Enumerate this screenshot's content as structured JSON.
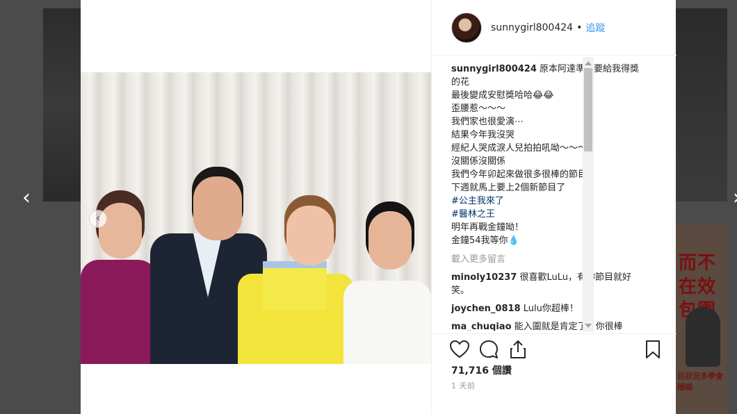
{
  "navigation": {
    "prev_label": "‹",
    "next_label": "›"
  },
  "header": {
    "avatar_icon": "profile-avatar",
    "username": "sunnygirl800424",
    "separator": "•",
    "follow_label": "追蹤",
    "follow_color": "#3897f0"
  },
  "caption": {
    "username": "sunnygirl800424",
    "lines": [
      "原本阿達準備要給我得獎",
      "的花",
      "最後變成安慰獎哈哈😂😂",
      "歪腰惹～～～",
      "我們家也很愛演⋯",
      "結果今年我沒哭",
      "經紀人哭成淚人兒拍拍吼呦～～～",
      "沒關係沒關係",
      "我們今年卯起來做很多很棒的節目",
      "下週就馬上要上2個新節目了"
    ],
    "hashtags": [
      "#公主我來了",
      "#醫林之王"
    ],
    "lines_after": [
      "明年再戰金鐘呦！",
      "金鐘54我等你💧"
    ]
  },
  "load_more_label": "載入更多留言",
  "comments": [
    {
      "user": "minoly10237",
      "text": "很喜歡LuLu，有妳節目就好",
      "text2": "笑。"
    },
    {
      "user": "joychen_0818",
      "text": "Lulu你超棒！"
    },
    {
      "user": "ma_chuqiao",
      "text": "能入圍就是肯定了！你很棒"
    }
  ],
  "stats": {
    "views": "71,716 個讚",
    "time": "1 天前"
  },
  "icons": [
    "heart-icon",
    "comment-icon",
    "share-icon",
    "bookmark-icon",
    "chevron-left-icon",
    "chevron-right-icon"
  ],
  "background_ad": {
    "headline": "而不在效包園",
    "sub": "目狀況多學會隱瞞"
  }
}
